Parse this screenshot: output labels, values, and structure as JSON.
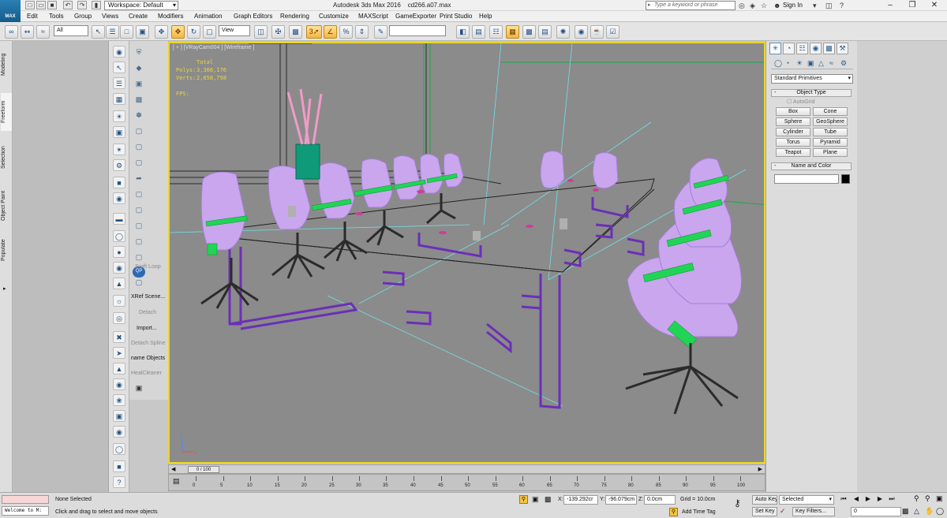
{
  "titlebar": {
    "app_title": "Autodesk 3ds Max 2016",
    "file_name": "cd266.a07.max",
    "workspace_label": "Workspace: Default",
    "logo_text": "MAX",
    "search_placeholder": "Type a keyword or phrase",
    "sign_in": "Sign In"
  },
  "menu": [
    "Edit",
    "Tools",
    "Group",
    "Views",
    "Create",
    "Modifiers",
    "Animation",
    "Graph Editors",
    "Rendering",
    "Customize",
    "MAXScript",
    "GameExporter",
    "Print Studio",
    "Help"
  ],
  "toolbar": {
    "selection_filter": "All",
    "ref_coord": "View",
    "named_sel": "",
    "snap_count": "3"
  },
  "ribbon_tabs": [
    "Modeling",
    "Freeform",
    "Selection",
    "Object Paint",
    "Populate"
  ],
  "cmd_labels": {
    "swift_loop": "Swift Loop",
    "xref_scene": "XRef Scene...",
    "detach": "Detach",
    "import": "Import...",
    "detach_spline": "Detach Spline",
    "rename_objects": "name Objects",
    "heal_cleaner": "HealCleaner"
  },
  "viewport": {
    "label": "[ + ] [VRayCam004 ] [Wireframe ]",
    "stats_total": "Total",
    "polys_label": "Polys:",
    "polys_value": "3,366,176",
    "verts_label": "Verts:",
    "verts_value": "2,658,798",
    "fps_label": "FPS:",
    "axis_z": "z",
    "axis_x": "x"
  },
  "command_panel": {
    "category": "Standard Primitives",
    "object_type_header": "Object Type",
    "autogrid": "AutoGrid",
    "objects": [
      "Box",
      "Cone",
      "Sphere",
      "GeoSphere",
      "Cylinder",
      "Tube",
      "Torus",
      "Pyramid",
      "Teapot",
      "Plane"
    ],
    "name_color_header": "Name and Color",
    "name_value": "",
    "color": "#000000"
  },
  "timeline": {
    "frame_display": "0 / 100",
    "ticks": [
      0,
      5,
      10,
      15,
      20,
      25,
      30,
      35,
      40,
      45,
      50,
      55,
      60,
      65,
      70,
      75,
      80,
      85,
      90,
      95,
      100
    ]
  },
  "status": {
    "listener_text": "Welcome to M:",
    "selection": "None Selected",
    "prompt": "Click and drag to select and move objects",
    "x_label": "X:",
    "x_value": "-139.292cr",
    "y_label": "Y:",
    "y_value": "-96.079cm",
    "z_label": "Z:",
    "z_value": "0.0cm",
    "grid": "Grid = 10.0cm",
    "add_time_tag": "Add Time Tag",
    "auto_key": "Auto Key",
    "set_key": "Set Key",
    "key_mode": "Selected",
    "key_filters": "Key Filters...",
    "current_frame": "0"
  },
  "colors": {
    "viewport_bg": "#8b8b8b",
    "active_border": "#e8d62a",
    "chair_fill": "#c9a6ee",
    "accent_green": "#22d456",
    "frame_purple": "#6b2fb8"
  }
}
